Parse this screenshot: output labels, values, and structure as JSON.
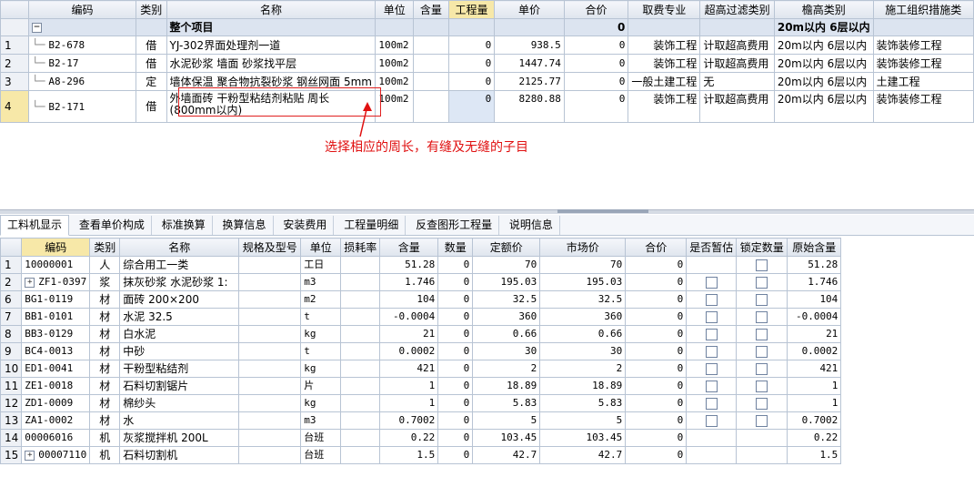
{
  "top": {
    "headers": [
      "编码",
      "类别",
      "名称",
      "单位",
      "含量",
      "工程量",
      "单价",
      "合价",
      "取费专业",
      "超高过滤类别",
      "檐高类别",
      "施工组织措施类"
    ],
    "group_row": {
      "toggle": "−",
      "name": "整个项目",
      "total": "0",
      "eave": "20m以内 6层以内"
    },
    "rows": [
      {
        "rn": "1",
        "code": "B2-678",
        "cat": "借",
        "name": "YJ-302界面处理剂一道",
        "unit": "100m2",
        "content": "",
        "qty": "0",
        "price": "938.5",
        "total": "0",
        "fee": "装饰工程",
        "filter": "计取超高费用",
        "eave": "20m以内 6层以内",
        "org": "装饰装修工程"
      },
      {
        "rn": "2",
        "code": "B2-17",
        "cat": "借",
        "name": "水泥砂浆 墙面 砂浆找平层",
        "unit": "100m2",
        "content": "",
        "qty": "0",
        "price": "1447.74",
        "total": "0",
        "fee": "装饰工程",
        "filter": "计取超高费用",
        "eave": "20m以内 6层以内",
        "org": "装饰装修工程"
      },
      {
        "rn": "3",
        "code": "A8-296",
        "cat": "定",
        "name": "墙体保温 聚合物抗裂砂浆 钢丝网面 5mm",
        "unit": "100m2",
        "content": "",
        "qty": "0",
        "price": "2125.77",
        "total": "0",
        "fee": "一般土建工程",
        "filter": "无",
        "eave": "20m以内 6层以内",
        "org": "土建工程"
      },
      {
        "rn": "4",
        "code": "B2-171",
        "cat": "借",
        "name": "外墙面砖 干粉型粘结剂粘贴 周长(800mm以内)",
        "unit": "100m2",
        "content": "",
        "qty": "0",
        "price": "8280.88",
        "total": "0",
        "fee": "装饰工程",
        "filter": "计取超高费用",
        "eave": "20m以内 6层以内",
        "org": "装饰装修工程"
      }
    ]
  },
  "annotation": "选择相应的周长，有缝及无缝的子目",
  "tabs": [
    "工料机显示",
    "查看单价构成",
    "标准换算",
    "换算信息",
    "安装费用",
    "工程量明细",
    "反查图形工程量",
    "说明信息"
  ],
  "bottom": {
    "headers": [
      "编码",
      "类别",
      "名称",
      "规格及型号",
      "单位",
      "损耗率",
      "含量",
      "数量",
      "定额价",
      "市场价",
      "合价",
      "是否暂估",
      "锁定数量",
      "原始含量"
    ],
    "rows": [
      {
        "rn": "1",
        "expand": "",
        "code": "10000001",
        "cat": "人",
        "name": "综合用工一类",
        "spec": "",
        "unit": "工日",
        "loss": "",
        "content": "51.28",
        "qty": "0",
        "base": "70",
        "market": "70",
        "total": "0",
        "est": "",
        "lock": "box",
        "orig": "51.28"
      },
      {
        "rn": "2",
        "expand": "+",
        "code": "ZF1-0397",
        "cat": "浆",
        "name": "抹灰砂浆 水泥砂浆 1:",
        "spec": "",
        "unit": "m3",
        "loss": "",
        "content": "1.746",
        "qty": "0",
        "base": "195.03",
        "market": "195.03",
        "total": "0",
        "est": "box",
        "lock": "box",
        "orig": "1.746"
      },
      {
        "rn": "6",
        "expand": "",
        "code": "BG1-0119",
        "cat": "材",
        "name": "面砖 200×200",
        "spec": "",
        "unit": "m2",
        "loss": "",
        "content": "104",
        "qty": "0",
        "base": "32.5",
        "market": "32.5",
        "total": "0",
        "est": "box",
        "lock": "box",
        "orig": "104"
      },
      {
        "rn": "7",
        "expand": "",
        "code": "BB1-0101",
        "cat": "材",
        "name": "水泥 32.5",
        "spec": "",
        "unit": "t",
        "loss": "",
        "content": "-0.0004",
        "qty": "0",
        "base": "360",
        "market": "360",
        "total": "0",
        "est": "box",
        "lock": "box",
        "orig": "-0.0004"
      },
      {
        "rn": "8",
        "expand": "",
        "code": "BB3-0129",
        "cat": "材",
        "name": "白水泥",
        "spec": "",
        "unit": "kg",
        "loss": "",
        "content": "21",
        "qty": "0",
        "base": "0.66",
        "market": "0.66",
        "total": "0",
        "est": "box",
        "lock": "box",
        "orig": "21"
      },
      {
        "rn": "9",
        "expand": "",
        "code": "BC4-0013",
        "cat": "材",
        "name": "中砂",
        "spec": "",
        "unit": "t",
        "loss": "",
        "content": "0.0002",
        "qty": "0",
        "base": "30",
        "market": "30",
        "total": "0",
        "est": "box",
        "lock": "box",
        "orig": "0.0002"
      },
      {
        "rn": "10",
        "expand": "",
        "code": "ED1-0041",
        "cat": "材",
        "name": "干粉型粘结剂",
        "spec": "",
        "unit": "kg",
        "loss": "",
        "content": "421",
        "qty": "0",
        "base": "2",
        "market": "2",
        "total": "0",
        "est": "box",
        "lock": "box",
        "orig": "421"
      },
      {
        "rn": "11",
        "expand": "",
        "code": "ZE1-0018",
        "cat": "材",
        "name": "石料切割锯片",
        "spec": "",
        "unit": "片",
        "loss": "",
        "content": "1",
        "qty": "0",
        "base": "18.89",
        "market": "18.89",
        "total": "0",
        "est": "box",
        "lock": "box",
        "orig": "1"
      },
      {
        "rn": "12",
        "expand": "",
        "code": "ZD1-0009",
        "cat": "材",
        "name": "棉纱头",
        "spec": "",
        "unit": "kg",
        "loss": "",
        "content": "1",
        "qty": "0",
        "base": "5.83",
        "market": "5.83",
        "total": "0",
        "est": "box",
        "lock": "box",
        "orig": "1"
      },
      {
        "rn": "13",
        "expand": "",
        "code": "ZA1-0002",
        "cat": "材",
        "name": "水",
        "spec": "",
        "unit": "m3",
        "loss": "",
        "content": "0.7002",
        "qty": "0",
        "base": "5",
        "market": "5",
        "total": "0",
        "est": "box",
        "lock": "box",
        "orig": "0.7002"
      },
      {
        "rn": "14",
        "expand": "",
        "code": "00006016",
        "cat": "机",
        "name": "灰浆搅拌机 200L",
        "spec": "",
        "unit": "台班",
        "loss": "",
        "content": "0.22",
        "qty": "0",
        "base": "103.45",
        "market": "103.45",
        "total": "0",
        "est": "",
        "lock": "",
        "orig": "0.22"
      },
      {
        "rn": "15",
        "expand": "+",
        "code": "00007110",
        "cat": "机",
        "name": "石料切割机",
        "spec": "",
        "unit": "台班",
        "loss": "",
        "content": "1.5",
        "qty": "0",
        "base": "42.7",
        "market": "42.7",
        "total": "0",
        "est": "",
        "lock": "",
        "orig": "1.5"
      }
    ]
  },
  "colors": {
    "header_highlight": "#f7e8a8",
    "annotation": "#e01010",
    "grid_border": "#b8c4d4"
  }
}
